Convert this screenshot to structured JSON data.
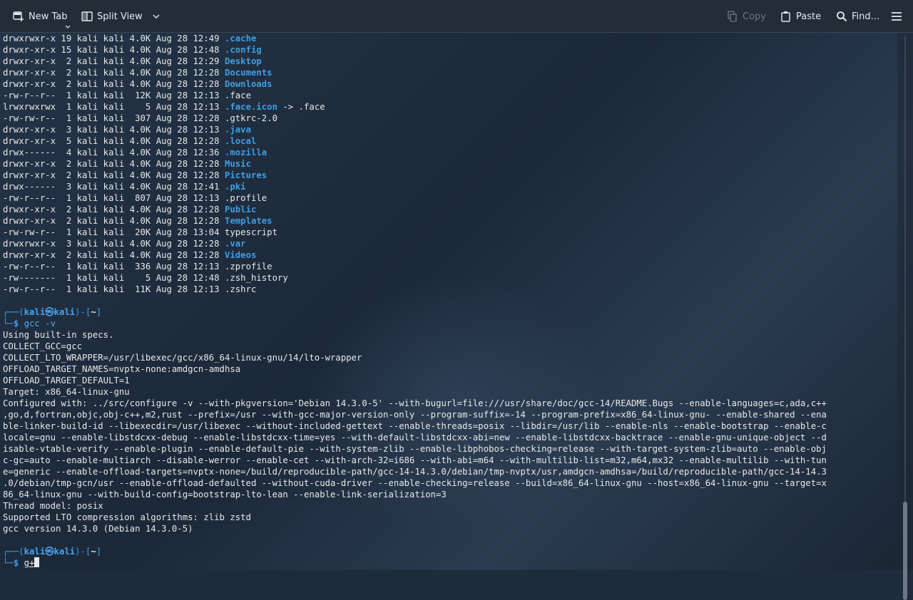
{
  "toolbar": {
    "new_tab": "New Tab",
    "split_view": "Split View",
    "copy": "Copy",
    "paste": "Paste",
    "find": "Find..."
  },
  "terminal": {
    "listing": [
      {
        "perm": "drwxrwxr-x",
        "n": "19",
        "u": "kali",
        "g": "kali",
        "size": "4.0K",
        "date": "Aug 28 12:49",
        "name": "cache",
        "dot": ".",
        "type": "dir"
      },
      {
        "perm": "drwxr-xr-x",
        "n": "15",
        "u": "kali",
        "g": "kali",
        "size": "4.0K",
        "date": "Aug 28 12:48",
        "name": ".config",
        "type": "dir"
      },
      {
        "perm": "drwxr-xr-x",
        "n": " 2",
        "u": "kali",
        "g": "kali",
        "size": "4.0K",
        "date": "Aug 28 12:29",
        "name": "Desktop",
        "type": "dir"
      },
      {
        "perm": "drwxr-xr-x",
        "n": " 2",
        "u": "kali",
        "g": "kali",
        "size": "4.0K",
        "date": "Aug 28 12:28",
        "name": "Documents",
        "type": "dir"
      },
      {
        "perm": "drwxr-xr-x",
        "n": " 2",
        "u": "kali",
        "g": "kali",
        "size": "4.0K",
        "date": "Aug 28 12:28",
        "name": "Downloads",
        "type": "dir"
      },
      {
        "perm": "-rw-r--r--",
        "n": " 1",
        "u": "kali",
        "g": "kali",
        "size": " 12K",
        "date": "Aug 28 12:13",
        "name": ".face",
        "type": "file"
      },
      {
        "perm": "lrwxrwxrwx",
        "n": " 1",
        "u": "kali",
        "g": "kali",
        "size": "   5",
        "date": "Aug 28 12:13",
        "name": ".face.icon",
        "target": " -> .face",
        "type": "link"
      },
      {
        "perm": "-rw-rw-r--",
        "n": " 1",
        "u": "kali",
        "g": "kali",
        "size": " 307",
        "date": "Aug 28 12:28",
        "name": ".gtkrc-2.0",
        "type": "file"
      },
      {
        "perm": "drwxr-xr-x",
        "n": " 3",
        "u": "kali",
        "g": "kali",
        "size": "4.0K",
        "date": "Aug 28 12:13",
        "name": ".java",
        "type": "dir"
      },
      {
        "perm": "drwxr-xr-x",
        "n": " 5",
        "u": "kali",
        "g": "kali",
        "size": "4.0K",
        "date": "Aug 28 12:28",
        "name": ".local",
        "type": "dir"
      },
      {
        "perm": "drwx------",
        "n": " 4",
        "u": "kali",
        "g": "kali",
        "size": "4.0K",
        "date": "Aug 28 12:36",
        "name": ".mozilla",
        "type": "dir"
      },
      {
        "perm": "drwxr-xr-x",
        "n": " 2",
        "u": "kali",
        "g": "kali",
        "size": "4.0K",
        "date": "Aug 28 12:28",
        "name": "Music",
        "type": "dir"
      },
      {
        "perm": "drwxr-xr-x",
        "n": " 2",
        "u": "kali",
        "g": "kali",
        "size": "4.0K",
        "date": "Aug 28 12:28",
        "name": "Pictures",
        "type": "dir"
      },
      {
        "perm": "drwx------",
        "n": " 3",
        "u": "kali",
        "g": "kali",
        "size": "4.0K",
        "date": "Aug 28 12:41",
        "name": ".pki",
        "type": "dir"
      },
      {
        "perm": "-rw-r--r--",
        "n": " 1",
        "u": "kali",
        "g": "kali",
        "size": " 807",
        "date": "Aug 28 12:13",
        "name": ".profile",
        "type": "file"
      },
      {
        "perm": "drwxr-xr-x",
        "n": " 2",
        "u": "kali",
        "g": "kali",
        "size": "4.0K",
        "date": "Aug 28 12:28",
        "name": "Public",
        "type": "dir"
      },
      {
        "perm": "drwxr-xr-x",
        "n": " 2",
        "u": "kali",
        "g": "kali",
        "size": "4.0K",
        "date": "Aug 28 12:28",
        "name": "Templates",
        "type": "dir"
      },
      {
        "perm": "-rw-rw-r--",
        "n": " 1",
        "u": "kali",
        "g": "kali",
        "size": " 20K",
        "date": "Aug 28 13:04",
        "name": "typescript",
        "type": "file"
      },
      {
        "perm": "drwxrwxr-x",
        "n": " 3",
        "u": "kali",
        "g": "kali",
        "size": "4.0K",
        "date": "Aug 28 12:28",
        "name": ".var",
        "type": "dir"
      },
      {
        "perm": "drwxr-xr-x",
        "n": " 2",
        "u": "kali",
        "g": "kali",
        "size": "4.0K",
        "date": "Aug 28 12:28",
        "name": "Videos",
        "type": "dir"
      },
      {
        "perm": "-rw-r--r--",
        "n": " 1",
        "u": "kali",
        "g": "kali",
        "size": " 336",
        "date": "Aug 28 12:13",
        "name": ".zprofile",
        "type": "file"
      },
      {
        "perm": "-rw-------",
        "n": " 1",
        "u": "kali",
        "g": "kali",
        "size": "   5",
        "date": "Aug 28 12:48",
        "name": ".zsh_history",
        "type": "file"
      },
      {
        "perm": "-rw-r--r--",
        "n": " 1",
        "u": "kali",
        "g": "kali",
        "size": " 11K",
        "date": "Aug 28 12:13",
        "name": ".zshrc",
        "type": "file"
      }
    ],
    "prompt": {
      "frame_top": "┌──(",
      "user": "kali㉿kali",
      "mid": ")-[",
      "path": "~",
      "end": "]",
      "frame_bottom": "└─",
      "dollar": "$ "
    },
    "command1": "gcc -v",
    "output": [
      "Using built-in specs.",
      "COLLECT_GCC=gcc",
      "COLLECT_LTO_WRAPPER=/usr/libexec/gcc/x86_64-linux-gnu/14/lto-wrapper",
      "OFFLOAD_TARGET_NAMES=nvptx-none:amdgcn-amdhsa",
      "OFFLOAD_TARGET_DEFAULT=1",
      "Target: x86_64-linux-gnu",
      "Configured with: ../src/configure -v --with-pkgversion='Debian 14.3.0-5' --with-bugurl=file:///usr/share/doc/gcc-14/README.Bugs --enable-languages=c,ada,c++",
      ",go,d,fortran,objc,obj-c++,m2,rust --prefix=/usr --with-gcc-major-version-only --program-suffix=-14 --program-prefix=x86_64-linux-gnu- --enable-shared --ena",
      "ble-linker-build-id --libexecdir=/usr/libexec --without-included-gettext --enable-threads=posix --libdir=/usr/lib --enable-nls --enable-bootstrap --enable-c",
      "locale=gnu --enable-libstdcxx-debug --enable-libstdcxx-time=yes --with-default-libstdcxx-abi=new --enable-libstdcxx-backtrace --enable-gnu-unique-object --d",
      "isable-vtable-verify --enable-plugin --enable-default-pie --with-system-zlib --enable-libphobos-checking=release --with-target-system-zlib=auto --enable-obj",
      "c-gc=auto --enable-multiarch --disable-werror --enable-cet --with-arch-32=i686 --with-abi=m64 --with-multilib-list=m32,m64,mx32 --enable-multilib --with-tun",
      "e=generic --enable-offload-targets=nvptx-none=/build/reproducible-path/gcc-14-14.3.0/debian/tmp-nvptx/usr,amdgcn-amdhsa=/build/reproducible-path/gcc-14-14.3",
      ".0/debian/tmp-gcn/usr --enable-offload-defaulted --without-cuda-driver --enable-checking=release --build=x86_64-linux-gnu --host=x86_64-linux-gnu --target=x",
      "86_64-linux-gnu --with-build-config=bootstrap-lto-lean --enable-link-serialization=3",
      "Thread model: posix",
      "Supported LTO compression algorithms: zlib zstd",
      "gcc version 14.3.0 (Debian 14.3.0-5)"
    ],
    "typed_input": "g+"
  },
  "colors": {
    "directory": "#3d9ee6",
    "prompt": "#3d9ee6",
    "text": "#e8e8e8",
    "toolbar_bg": "#232d38"
  }
}
